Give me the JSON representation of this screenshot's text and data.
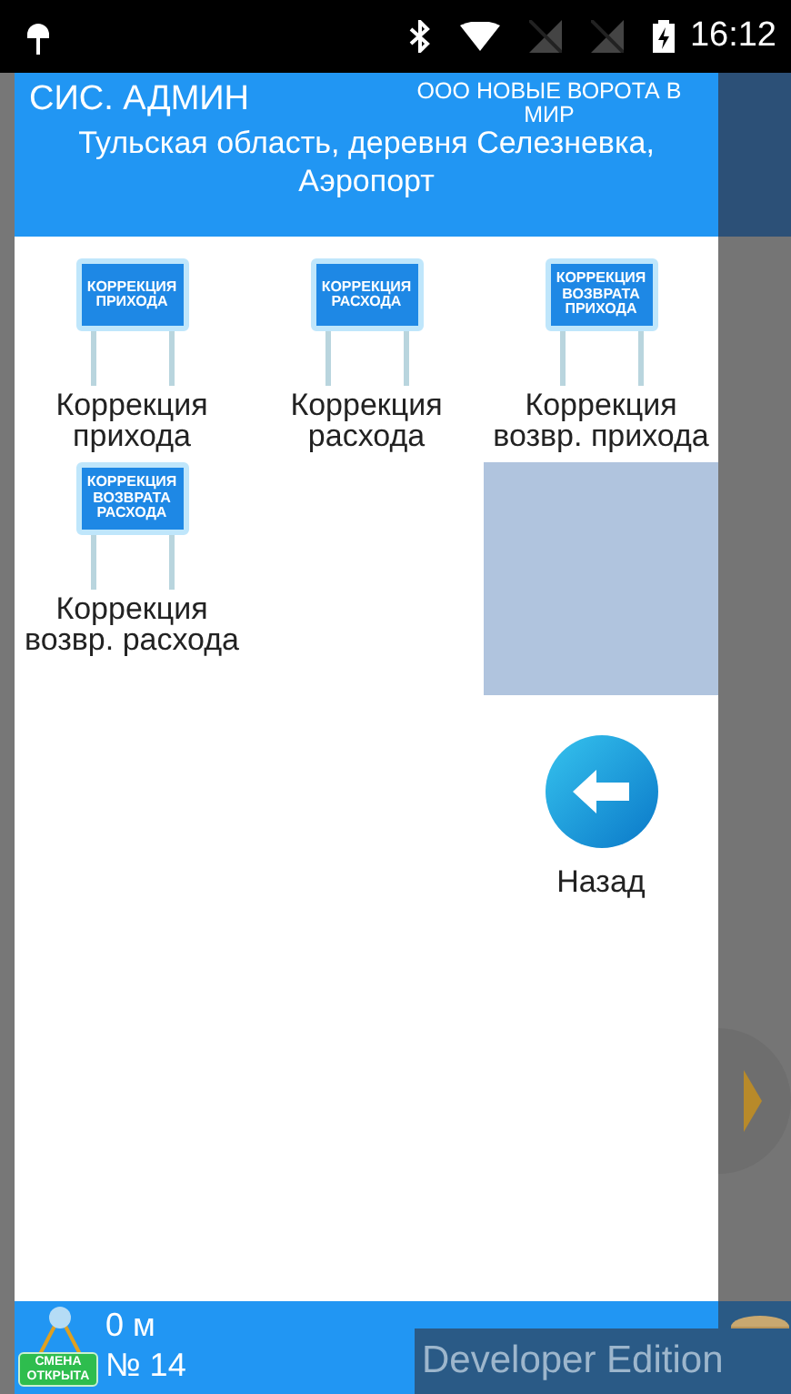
{
  "status_bar": {
    "time": "16:12"
  },
  "drawer": {
    "user": "СИС. АДМИН",
    "company": "ООО НОВЫЕ ВОРОТА В МИР",
    "address": "Тульская область, деревня Селезневка, Аэропорт",
    "tiles": [
      {
        "kind": "sign",
        "sign_text": "КОРРЕКЦИЯ ПРИХОДА",
        "label": "Коррекция прихода"
      },
      {
        "kind": "sign",
        "sign_text": "КОРРЕКЦИЯ РАСХОДА",
        "label": "Коррекция расхода"
      },
      {
        "kind": "sign",
        "sign_text": "КОРРЕКЦИЯ ВОЗВРАТА ПРИХОДА",
        "label": "Коррекция возвр. прихода"
      },
      {
        "kind": "sign",
        "sign_text": "КОРРЕКЦИЯ ВОЗВРАТА РАСХОДА",
        "label": "Коррекция возвр. расхода"
      }
    ],
    "back_button": {
      "label": "Назад"
    },
    "footer": {
      "distance": "0 м",
      "shift_badge": "СМЕНА ОТКРЫТА",
      "number": "№ 14"
    }
  },
  "edition": "Developer Edition"
}
